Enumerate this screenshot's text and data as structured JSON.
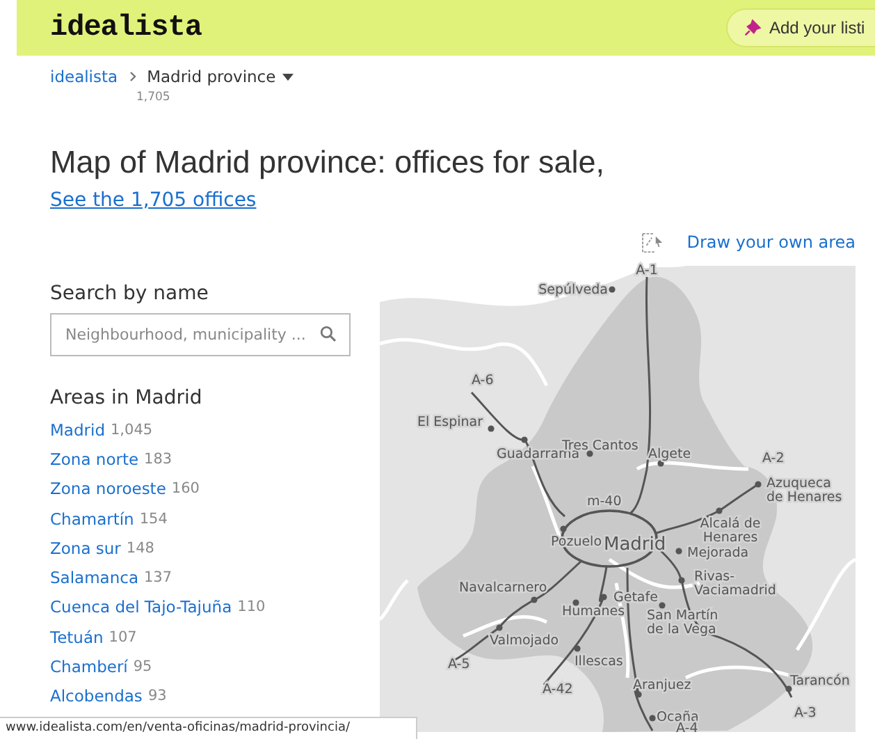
{
  "header": {
    "logo": "idealista",
    "button": "Add your listi"
  },
  "breadcrumb": {
    "home": "idealista",
    "current": "Madrid province",
    "count": "1,705"
  },
  "title": "Map of Madrid province: offices for sale,",
  "see_link": "See the 1,705 offices",
  "draw_link": "Draw your own area",
  "search": {
    "heading": "Search by name",
    "placeholder": "Neighbourhood, municipality ..."
  },
  "areas": {
    "heading": "Areas in Madrid",
    "items": [
      {
        "name": "Madrid",
        "count": "1,045"
      },
      {
        "name": "Zona norte",
        "count": "183"
      },
      {
        "name": "Zona noroeste",
        "count": "160"
      },
      {
        "name": "Chamartín",
        "count": "154"
      },
      {
        "name": "Zona sur",
        "count": "148"
      },
      {
        "name": "Salamanca",
        "count": "137"
      },
      {
        "name": "Cuenca del Tajo-Tajuña",
        "count": "110"
      },
      {
        "name": "Tetuán",
        "count": "107"
      },
      {
        "name": "Chamberí",
        "count": "95"
      },
      {
        "name": "Alcobendas",
        "count": "93"
      }
    ]
  },
  "map": {
    "labels": [
      {
        "kind": "road",
        "lines": [
          "A-1"
        ]
      },
      {
        "kind": "town",
        "lines": [
          "Sepúlveda"
        ]
      },
      {
        "kind": "road",
        "lines": [
          "A-6"
        ]
      },
      {
        "kind": "town",
        "lines": [
          "El Espinar"
        ]
      },
      {
        "kind": "town",
        "lines": [
          "Guadarrama"
        ]
      },
      {
        "kind": "town",
        "lines": [
          "Tres Cantos"
        ]
      },
      {
        "kind": "town",
        "lines": [
          "Algete"
        ]
      },
      {
        "kind": "road",
        "lines": [
          "A-2"
        ]
      },
      {
        "kind": "town",
        "lines": [
          "Azuqueca",
          "de Henares"
        ]
      },
      {
        "kind": "road",
        "lines": [
          "m-40"
        ]
      },
      {
        "kind": "town",
        "lines": [
          "Pozuelo"
        ]
      },
      {
        "kind": "city",
        "lines": [
          "Madrid"
        ]
      },
      {
        "kind": "town",
        "lines": [
          "Alcalá de",
          "Henares"
        ]
      },
      {
        "kind": "town",
        "lines": [
          "Mejorada"
        ]
      },
      {
        "kind": "town",
        "lines": [
          "Navalcarnero"
        ]
      },
      {
        "kind": "town",
        "lines": [
          "Rivas-",
          "Vaciamadrid"
        ]
      },
      {
        "kind": "town",
        "lines": [
          "Getafe"
        ]
      },
      {
        "kind": "town",
        "lines": [
          "Humanes"
        ]
      },
      {
        "kind": "town",
        "lines": [
          "San Martín",
          "de la Vega"
        ]
      },
      {
        "kind": "town",
        "lines": [
          "Valmojado"
        ]
      },
      {
        "kind": "road",
        "lines": [
          "A-5"
        ]
      },
      {
        "kind": "town",
        "lines": [
          "Illescas"
        ]
      },
      {
        "kind": "road",
        "lines": [
          "A-42"
        ]
      },
      {
        "kind": "town",
        "lines": [
          "Aranjuez"
        ]
      },
      {
        "kind": "town",
        "lines": [
          "Tarancón"
        ]
      },
      {
        "kind": "road",
        "lines": [
          "A-3"
        ]
      },
      {
        "kind": "town",
        "lines": [
          "Ocaña"
        ]
      },
      {
        "kind": "road",
        "lines": [
          "A-4"
        ]
      }
    ]
  },
  "status_bar": "www.idealista.com/en/venta-oficinas/madrid-provincia/"
}
